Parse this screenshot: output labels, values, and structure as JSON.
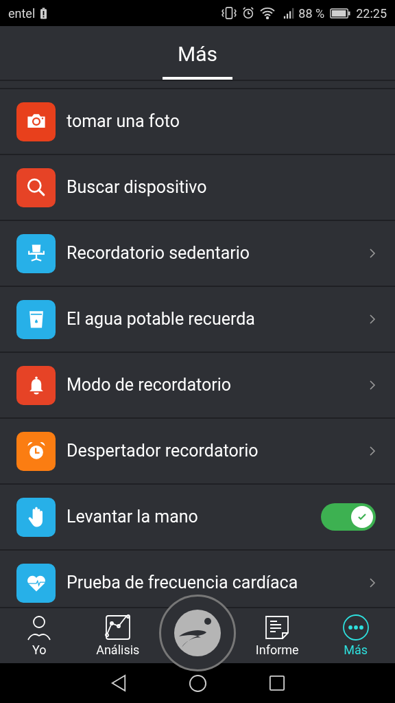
{
  "status_bar": {
    "carrier": "entel",
    "battery": "88 %",
    "time": "22:25"
  },
  "header": {
    "title": "Más"
  },
  "items": [
    {
      "label": "tomar una foto",
      "kind": "plain",
      "color": "#e8401c"
    },
    {
      "label": "Buscar dispositivo",
      "kind": "plain",
      "color": "#e64326"
    },
    {
      "label": "Recordatorio sedentario",
      "kind": "chevron",
      "color": "#27b0e8"
    },
    {
      "label": "El agua potable recuerda",
      "kind": "chevron",
      "color": "#27b0e8"
    },
    {
      "label": "Modo de recordatorio",
      "kind": "chevron",
      "color": "#e64326"
    },
    {
      "label": "Despertador recordatorio",
      "kind": "chevron",
      "color": "#fb7d12"
    },
    {
      "label": "Levantar la mano",
      "kind": "toggle",
      "color": "#27b0e8",
      "on": true
    },
    {
      "label": "Prueba de frecuencia cardíaca",
      "kind": "chevron",
      "color": "#27b0e8"
    }
  ],
  "tabs": [
    {
      "label": "Yo",
      "selected": false
    },
    {
      "label": "Análisis",
      "selected": false
    },
    {
      "label": "Informe",
      "selected": false
    },
    {
      "label": "Más",
      "selected": true
    }
  ]
}
